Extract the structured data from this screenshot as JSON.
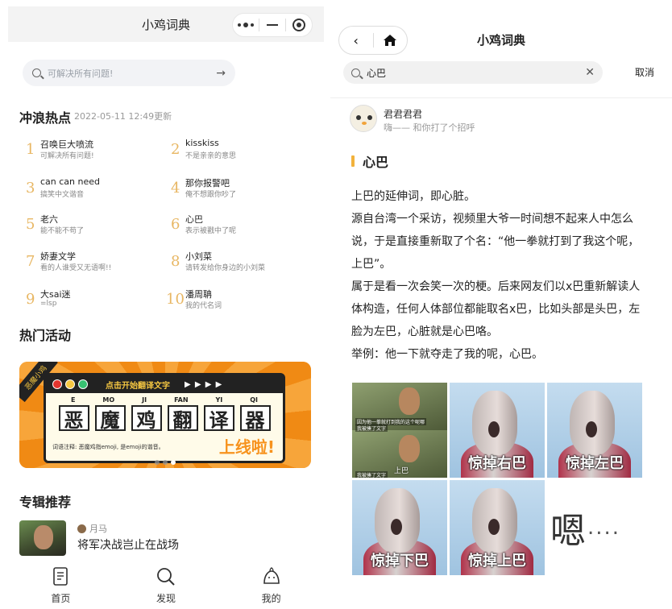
{
  "left": {
    "app_title": "小鸡词典",
    "search_placeholder": "可解决所有问题!",
    "hot": {
      "title": "冲浪热点",
      "updated": "2022-05-11 12:49更新",
      "items": [
        {
          "rank": "1",
          "word": "召唤巨大喷流",
          "desc": "可解决所有问题!"
        },
        {
          "rank": "2",
          "word": "kisskiss",
          "desc": "不是亲亲的意思"
        },
        {
          "rank": "3",
          "word": "can can need",
          "desc": "搞笑中文谐音"
        },
        {
          "rank": "4",
          "word": "那你报警吧",
          "desc": "俺不想跟你吵了"
        },
        {
          "rank": "5",
          "word": "老六",
          "desc": "能不能不苟了"
        },
        {
          "rank": "6",
          "word": "心巴",
          "desc": "表示被戳中了呢"
        },
        {
          "rank": "7",
          "word": "娇妻文学",
          "desc": "看的人谁受又无语啊!!"
        },
        {
          "rank": "8",
          "word": "小刘菜",
          "desc": "请转发给你身边的小刘菜"
        },
        {
          "rank": "9",
          "word": "大sai迷",
          "desc": "=lsp"
        },
        {
          "rank": "10",
          "word": "潘周聃",
          "desc": "我的代名词"
        }
      ]
    },
    "activity": {
      "title": "热门活动",
      "banner": {
        "badge": "恶魔小鸡",
        "headline": "点击开始翻译文字",
        "play": "▶ ▶ ▶ ▶",
        "pinyin": [
          "E",
          "MO",
          "JI",
          "FAN",
          "YI",
          "QI"
        ],
        "hanzi": [
          "恶",
          "魔",
          "鸡",
          "翻",
          "译",
          "器"
        ],
        "note": "词语注释: 恶魔鸡指emoji, 是emoji的谐音。",
        "launch": "上线啦!"
      }
    },
    "album": {
      "title": "专辑推荐",
      "author": "月马",
      "name": "将军决战岂止在战场"
    },
    "tabs": [
      {
        "label": "首页"
      },
      {
        "label": "发现"
      },
      {
        "label": "我的"
      }
    ]
  },
  "right": {
    "app_title": "小鸡词典",
    "search_value": "心巴",
    "cancel": "取消",
    "user": {
      "name": "君君君君",
      "sign": "嗨—— 和你打了个招呼"
    },
    "word": "心巴",
    "definition": [
      "上巴的延伸词，即心脏。",
      "源自台湾一个采访，视频里大爷一时间想不起来人中怎么说，于是直接重新取了个名：“他一拳就打到了我这个呢，上巴”。",
      "属于是看一次会笑一次的梗。后来网友们以x巴重新解读人体构造，任何人体部位都能取名x巴，比如头部是头巴，左脸为左巴，心脏就是心巴咯。",
      "举例：他一下就夺走了我的呢，心巴。"
    ],
    "images": {
      "meme_sub1": "因为他一拳就打到我的这个呢哪",
      "meme_sub2": "我被揍了文字",
      "meme_sub3": "上巴",
      "meme_sub4": "我被揍了文字",
      "captions": [
        "惊掉右巴",
        "惊掉左巴",
        "惊掉下巴",
        "惊掉上巴"
      ],
      "en_text": "嗯",
      "en_dots": "...."
    }
  }
}
